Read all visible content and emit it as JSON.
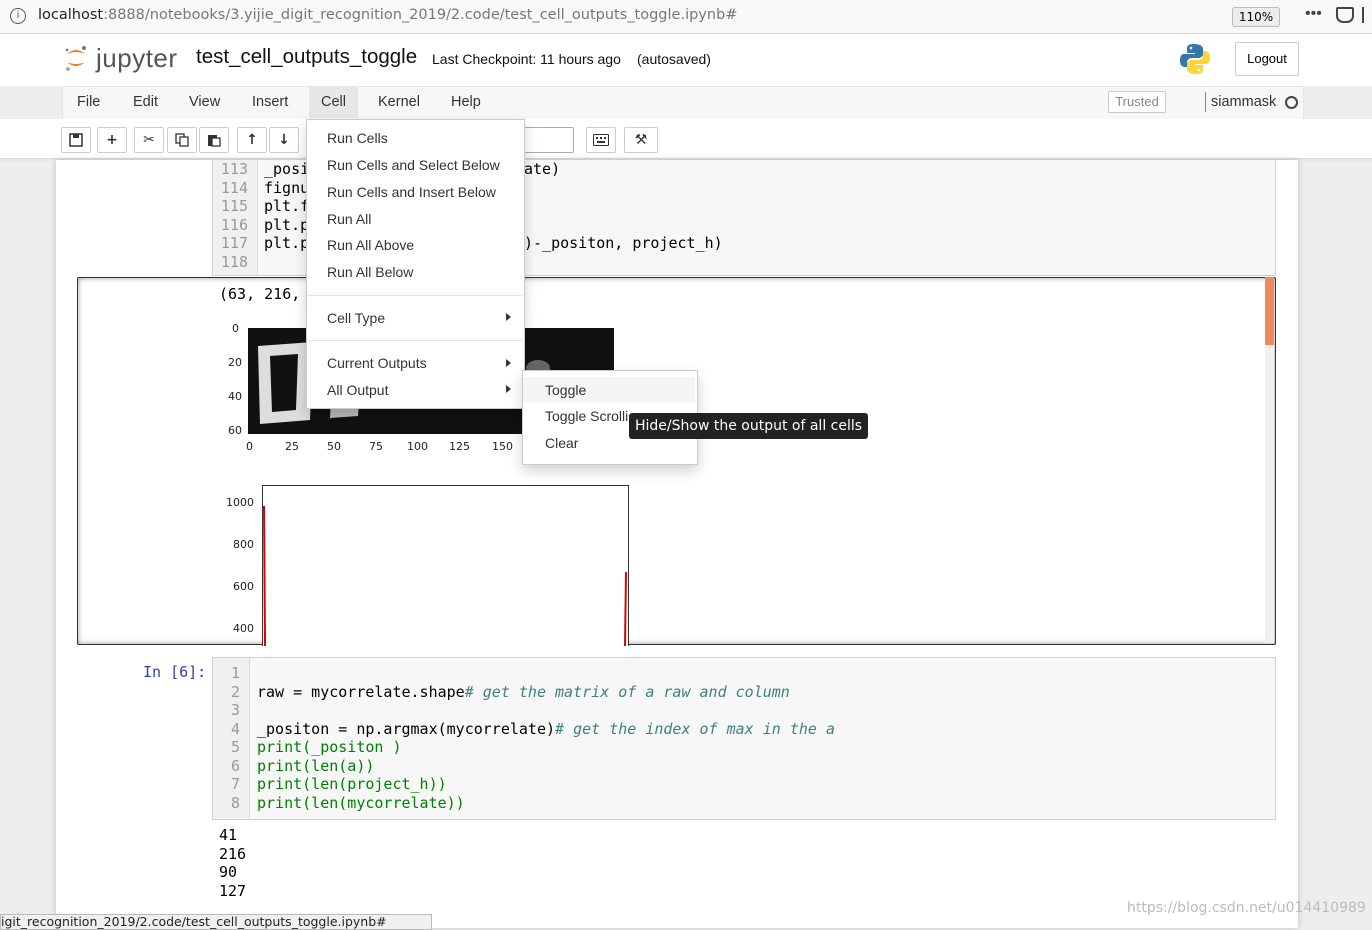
{
  "browser": {
    "url_host": "localhost",
    "url_path": ":8888/notebooks/3.yijie_digit_recognition_2019/2.code/test_cell_outputs_toggle.ipynb#",
    "zoom": "110%"
  },
  "header": {
    "logo_text": "jupyter",
    "notebook_name": "test_cell_outputs_toggle",
    "checkpoint": "Last Checkpoint: 11 hours ago",
    "autosave": "(autosaved)",
    "logout_label": "Logout"
  },
  "menubar": {
    "items": [
      "File",
      "Edit",
      "View",
      "Insert",
      "Cell",
      "Kernel",
      "Help"
    ],
    "trusted": "Trusted",
    "kernel_name": "siammask"
  },
  "toolbar": {
    "icons": [
      "save-icon",
      "plus-icon",
      "cut-icon",
      "copy-icon",
      "paste-icon",
      "arrow-up-icon",
      "arrow-down-icon",
      "keyboard-icon",
      "hammer-icon"
    ]
  },
  "cell1": {
    "line_numbers": [
      "113",
      "114",
      "115",
      "116",
      "117",
      "118"
    ],
    "code_lines": [
      "_posi",
      "fignu",
      "plt.f",
      "plt.p",
      "plt.p",
      ""
    ],
    "code_tail_0": "ate)",
    "code_tail_4": ")-_positon, project_h)",
    "output_text": "(63, 216,"
  },
  "image_plot": {
    "yticks": [
      "0",
      "20",
      "40",
      "60"
    ],
    "xticks": [
      "0",
      "25",
      "50",
      "75",
      "100",
      "125",
      "150"
    ]
  },
  "hist_plot": {
    "yticks": [
      "1000",
      "800",
      "600",
      "400"
    ]
  },
  "cell2": {
    "prompt": "In [6]:",
    "line_numbers": [
      "1",
      "2",
      "3",
      "4",
      "5",
      "6",
      "7",
      "8"
    ],
    "line2_code": "raw = mycorrelate.shape",
    "line2_comment": "# get the matrix of a raw and column",
    "line4_code": "_positon = np.argmax(mycorrelate)",
    "line4_comment": "# get the index of max in the a",
    "line5": "print(_positon )",
    "line6": "print(len(a))",
    "line7": "print(len(project_h))",
    "line8": "print(len(mycorrelate))",
    "output_lines": [
      "41",
      "216",
      "90",
      "127"
    ]
  },
  "cell_menu": {
    "group1": [
      "Run Cells",
      "Run Cells and Select Below",
      "Run Cells and Insert Below",
      "Run All",
      "Run All Above",
      "Run All Below"
    ],
    "cell_type": "Cell Type",
    "current_outputs": "Current Outputs",
    "all_output": "All Output"
  },
  "all_output_submenu": [
    "Toggle",
    "Toggle Scrolli",
    "Clear"
  ],
  "tooltip": "Hide/Show the output of all cells",
  "statusbar": "igit_recognition_2019/2.code/test_cell_outputs_toggle.ipynb#",
  "watermark": "https://blog.csdn.net/u014410989",
  "colors": {
    "prompt_in": "#303f9f",
    "keyword": "#008000",
    "operator": "#aa22ff",
    "comment": "#408080",
    "scroll_thumb": "#f08a5d"
  }
}
